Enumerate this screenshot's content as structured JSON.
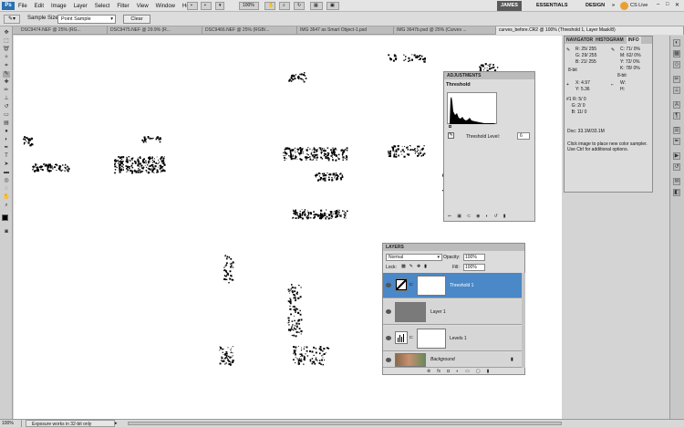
{
  "menubar": {
    "app_logo": "Ps",
    "menus": [
      "File",
      "Edit",
      "Image",
      "Layer",
      "Select",
      "Filter",
      "View",
      "Window",
      "Help"
    ],
    "zoom": "100%",
    "workspaces": [
      "JAMES",
      "ESSENTIALS",
      "DESIGN"
    ],
    "overflow": "»",
    "cs_live": "CS Live"
  },
  "options": {
    "sample_size_label": "Sample Size:",
    "sample_size_value": "Point Sample",
    "clear_label": "Clear"
  },
  "tabs": [
    "DSC9474.NEF @ 25% (RG...",
    "DSC9475.NEF @ 29.9% (R...",
    "DSC9466.NEF @ 25% (RGB/...",
    "IMG 3647 as Smart Object-1.psd",
    "IMG 3647b.psd @ 25% (Curves ...",
    "curves_before.CR2 @ 100% (Threshold 1, Layer Mask/8)"
  ],
  "adjustments": {
    "tab": "ADJUSTMENTS",
    "title": "Threshold",
    "level_label": "Threshold Level:",
    "level_value": "6"
  },
  "info": {
    "tabs": [
      "NAVIGATOR",
      "HISTOGRAM",
      "INFO"
    ],
    "r_label": "R:",
    "r": "25/ 255",
    "g_label": "G:",
    "g": "29/ 255",
    "b_label": "B:",
    "b": "21/ 255",
    "c_label": "C:",
    "c": "71/ 0%",
    "m_label": "M:",
    "m": "62/ 0%",
    "y_label": "Y:",
    "y": "72/ 0%",
    "k_label": "K:",
    "k": "78/ 0%",
    "bit_left": "8-bit",
    "bit_right": "8-bit",
    "x_label": "X:",
    "x": "4.97",
    "y2_label": "Y:",
    "y2": "5.36",
    "w_label": "W:",
    "h_label": "H:",
    "s1_label": "#1",
    "s1_r_label": "R:",
    "s1_r": "5/ 0",
    "s1_g_label": "G:",
    "s1_g": "2/ 0",
    "s1_b_label": "B:",
    "s1_b": "11/ 0",
    "doc": "Doc: 33.1M/33.1M",
    "hint": "Click image to place new color sampler. Use Ctrl for additional options."
  },
  "layers": {
    "tab": "LAYERS",
    "blend_mode": "Normal",
    "opacity_label": "Opacity:",
    "opacity_value": "100%",
    "lock_label": "Lock:",
    "fill_label": "Fill:",
    "fill_value": "100%",
    "items": [
      {
        "name": "Threshold 1"
      },
      {
        "name": "Layer 1"
      },
      {
        "name": "Levels 1"
      },
      {
        "name": "Background"
      }
    ]
  },
  "status": {
    "zoom": "100%",
    "message": "Exposure works in 32-bit only"
  },
  "colors": {
    "selection": "#4a88c8",
    "panel_bg": "#dcdcdc",
    "canvas": "#ffffff"
  }
}
